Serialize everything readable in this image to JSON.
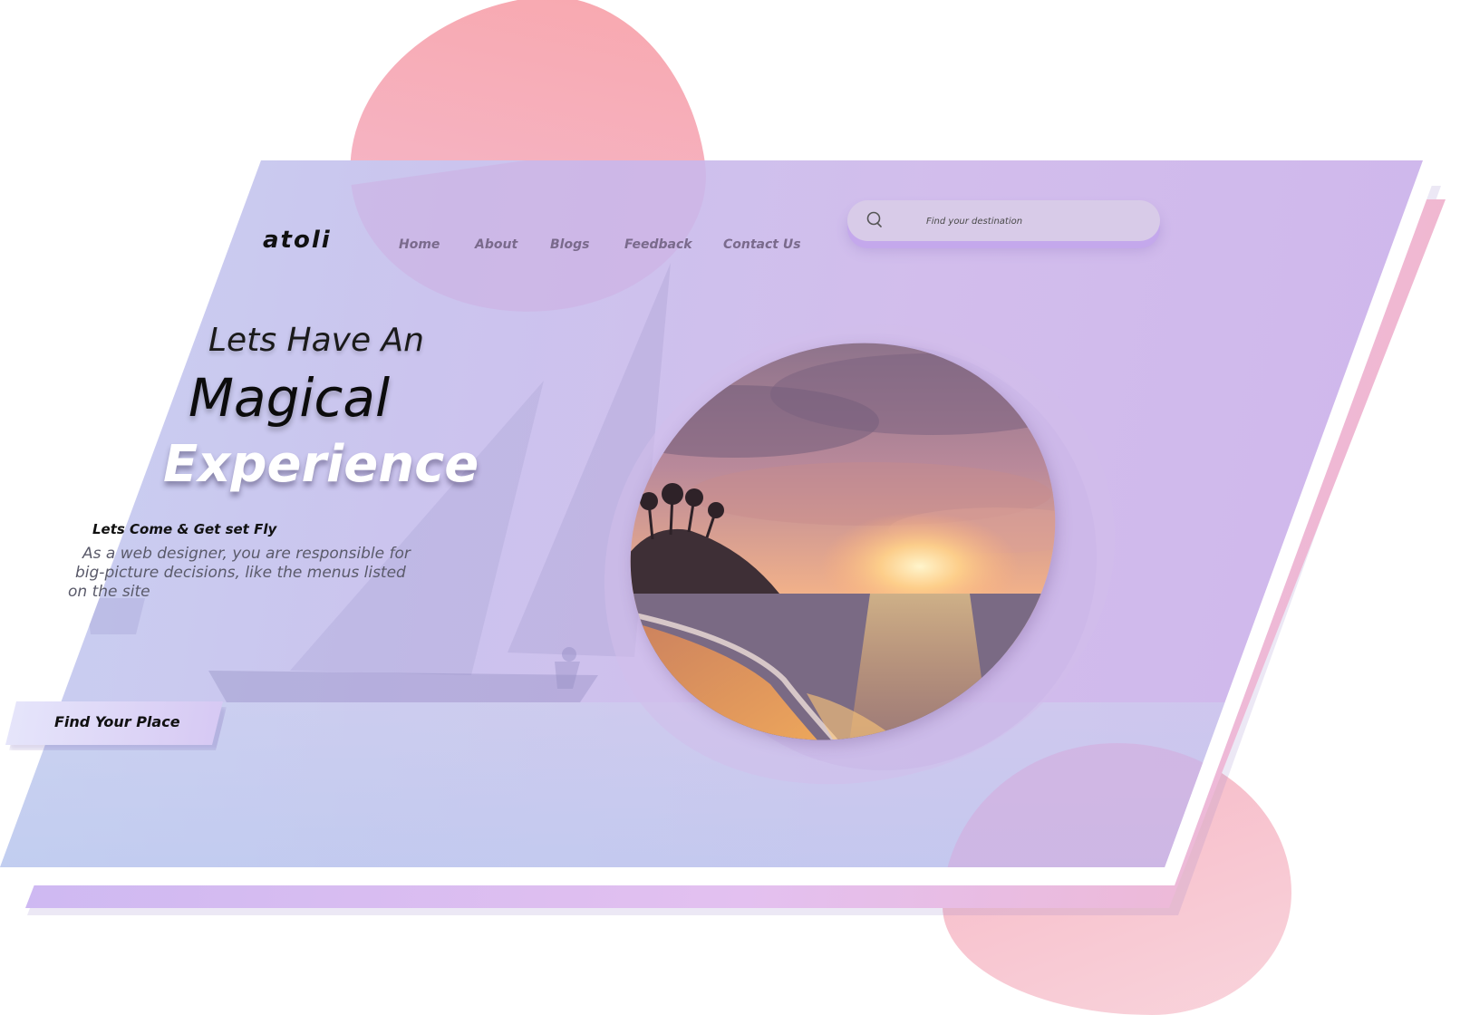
{
  "brand": {
    "logo": "atoli"
  },
  "nav": {
    "items": [
      {
        "label": "Home"
      },
      {
        "label": "About"
      },
      {
        "label": "Blogs"
      },
      {
        "label": "Feedback"
      },
      {
        "label": "Contact Us"
      }
    ]
  },
  "search": {
    "placeholder": "Find your destination",
    "icon": "search-icon"
  },
  "hero": {
    "line1": "Lets Have An",
    "line2": "Magical",
    "line3": "Experience",
    "tagline": "Lets Come & Get set Fly",
    "description": [
      "As a web designer, you are responsible for",
      "big-picture decisions, like the menus listed",
      "on the site"
    ],
    "cta_label": "Find Your Place"
  },
  "colors": {
    "panel_start": "#c8d2f1",
    "panel_end": "#ceb6ec",
    "blob_pink": "#f8a7ad",
    "accent_purple": "#c4a8ec"
  }
}
